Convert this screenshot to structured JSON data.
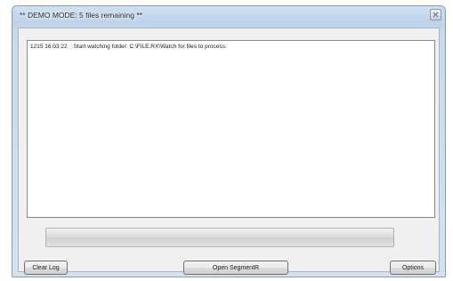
{
  "window": {
    "title": "** DEMO MODE: 5 files remaining **"
  },
  "log": {
    "entries": [
      {
        "timestamp": "1215 16:03:22",
        "message": "Start watching folder: C:\\FILE.RX\\Watch for files to process."
      }
    ]
  },
  "progress": {
    "value": 0
  },
  "buttons": {
    "clear_log": "Clear Log",
    "open_segmentr": "Open SegmentR",
    "options": "Options"
  },
  "icons": {
    "close": "close-icon"
  },
  "colors": {
    "titlebar": "#bcd3ea",
    "client_background": "#f0f0f0",
    "progress_fill": "#37b838"
  }
}
